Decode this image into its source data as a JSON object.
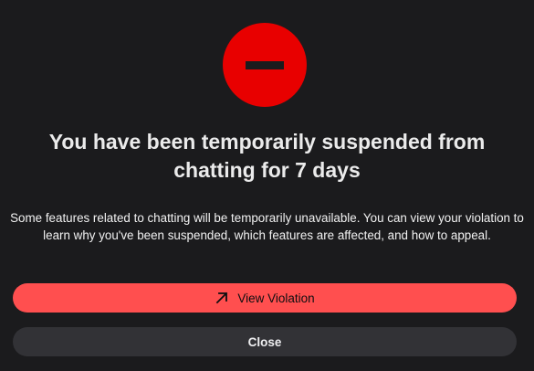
{
  "dialog": {
    "title": "You have been temporarily suspended from chatting for 7 days",
    "description": "Some features related to chatting will be temporarily unavailable. You can view your violation to learn why you've been suspended, which features are affected, and how to appeal.",
    "icon": "suspended-icon"
  },
  "buttons": {
    "view_violation": {
      "label": "View Violation",
      "icon": "external-arrow-icon"
    },
    "close": {
      "label": "Close"
    }
  },
  "colors": {
    "background": "#1b1b1d",
    "icon_red": "#e80000",
    "primary_button": "#ff4f4f",
    "secondary_button": "#323236"
  }
}
